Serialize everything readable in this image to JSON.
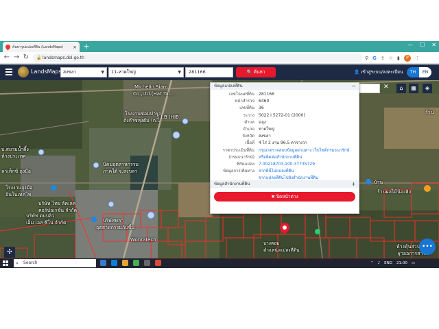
{
  "browser": {
    "tab_title": "ค้นหารูปแปลงที่ดิน (LandsMaps)",
    "tab_close": "×",
    "new_tab": "+",
    "url": "landsmaps.dol.go.th",
    "profile_initial": "P",
    "google_icon_text": "G"
  },
  "header": {
    "brand": "LandsMaps",
    "province": "สงขลา",
    "district": "11-หาดใหญ่",
    "parcel_no": "281166",
    "search_label": "ค้นหา",
    "login_label": "เข้าสู่ระบบ/ลงทะเบียน",
    "lang_th": "TH",
    "lang_en": "EN"
  },
  "map": {
    "place_search_placeholder": "ค้นหาสถานที่สำคัญ",
    "labels": [
      "Michelin Siam",
      "Co.,Ltd.(Hat Yai...",
      "S.I.B (HIB)",
      "โรงงานซ่อมบำรุง",
      "ถังก๊าซหุงต้ม (ก...",
      "นิคมอุตสาหกรรม",
      "ภาคใต้ จ.สงขลา",
      "บ.สยามน้ำผึ้ง",
      "ห้างประเทศ",
      "ลาเท็กซ์ ถุงมือ",
      "โรงงานถุงมือ",
      "อินโนเทคไท",
      "บริษัท ไทย ลัคเลค",
      "คอร์ปอเรชั่น จำกัด",
      "บริษัท ดบบลิว",
      "เอ็ม เอส ซีโป จำกัด",
      "บริษัทพลา",
      "อุตสาหกรรมกับขี้น",
      "Wonratech",
      "ร้าน",
      "บ้าน",
      "ร้านผลไม้น้องฮิง",
      "ห้างหุ้นส่วนจำกัด",
      "ฐาออการสาวร"
    ],
    "pin_label_line1": "บางคอม",
    "pin_label_line2": "ตำแหน่งแปลงที่ดิน"
  },
  "panel": {
    "section1_title": "ข้อมูลแปลงที่ดิน",
    "rows": [
      {
        "label": "เลขโฉนดที่ดิน",
        "value": "281166",
        "link": false
      },
      {
        "label": "หน้าสำรวจ",
        "value": "6460",
        "link": false
      },
      {
        "label": "เลขที่ดิน",
        "value": "36",
        "link": false
      },
      {
        "label": "ระวาง",
        "value": "5022 I 5272-01 (2000)",
        "link": false
      },
      {
        "label": "ตำบล",
        "value": "ฉลุง",
        "link": false
      },
      {
        "label": "อำเภอ",
        "value": "หาดใหญ่",
        "link": false
      },
      {
        "label": "จังหวัด",
        "value": "สงขลา",
        "link": false
      },
      {
        "label": "เนื้อที่",
        "value": "4 ไร่ 3 งาน 96.5 ตารางวา",
        "link": false
      },
      {
        "label": "ราคาประเมินที่ดิน",
        "value": "กรุณาตรวจสอบข้อมูลผ่านทาง เว็บไซต์กรมธนารักษ์",
        "link": true
      },
      {
        "label": "(กรมธนารักษ์)",
        "value": "หรือติดต่อสำนักงานที่ดิน",
        "link": true
      },
      {
        "label": "พิกัดแปลง",
        "value": "7.00218703,100.37735729",
        "link": true
      },
      {
        "label": "ข้อมูลการเดินทาง",
        "value": "จากที่นี่ไปแปลงที่ดิน",
        "link": true
      },
      {
        "label": "",
        "value": "จากแปลงที่ดินไปยังสำนักงานที่ดิน",
        "link": true
      }
    ],
    "section2_title": "ข้อมูลสำนักงานที่ดิน",
    "close_label": "✖ ปิดหน้าต่าง"
  },
  "taskbar": {
    "search_label": "Search",
    "lang": "ENG",
    "time": "21:00"
  },
  "colors": {
    "accent_red": "#e8192c",
    "header_navy": "#1e2a44",
    "tab_teal": "#3aa6a0",
    "parcel_line": "#ff2b2b"
  }
}
